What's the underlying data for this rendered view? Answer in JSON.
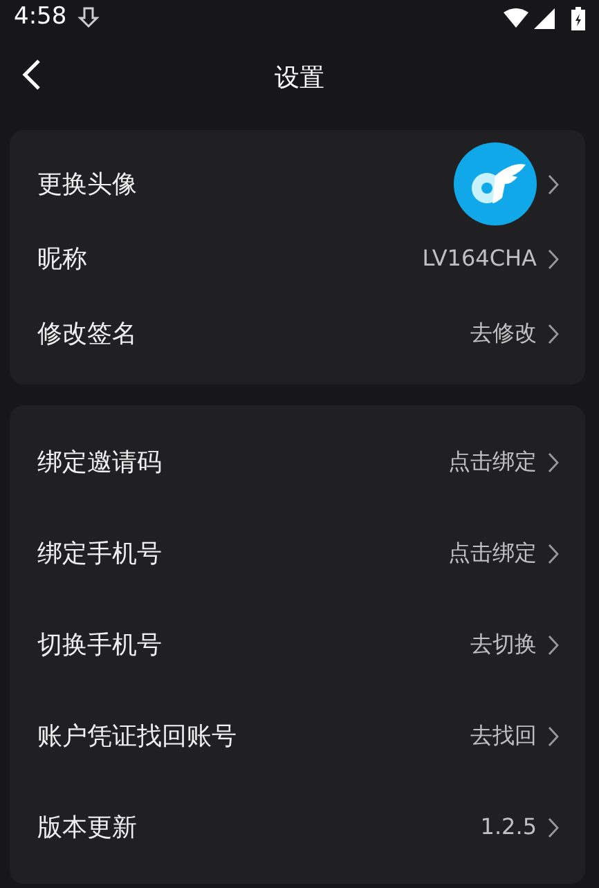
{
  "status_bar": {
    "time": "4:58"
  },
  "header": {
    "title": "设置"
  },
  "groups": [
    {
      "items": [
        {
          "kind": "avatar",
          "label": "更换头像"
        },
        {
          "kind": "text",
          "label": "昵称",
          "value": "LV164CHA"
        },
        {
          "kind": "text",
          "label": "修改签名",
          "value": "去修改"
        }
      ]
    },
    {
      "items": [
        {
          "kind": "text",
          "label": "绑定邀请码",
          "value": "点击绑定"
        },
        {
          "kind": "text",
          "label": "绑定手机号",
          "value": "点击绑定"
        },
        {
          "kind": "text",
          "label": "切换手机号",
          "value": "去切换"
        },
        {
          "kind": "text",
          "label": "账户凭证找回账号",
          "value": "去找回"
        },
        {
          "kind": "text",
          "label": "版本更新",
          "value": "1.2.5"
        }
      ]
    }
  ]
}
